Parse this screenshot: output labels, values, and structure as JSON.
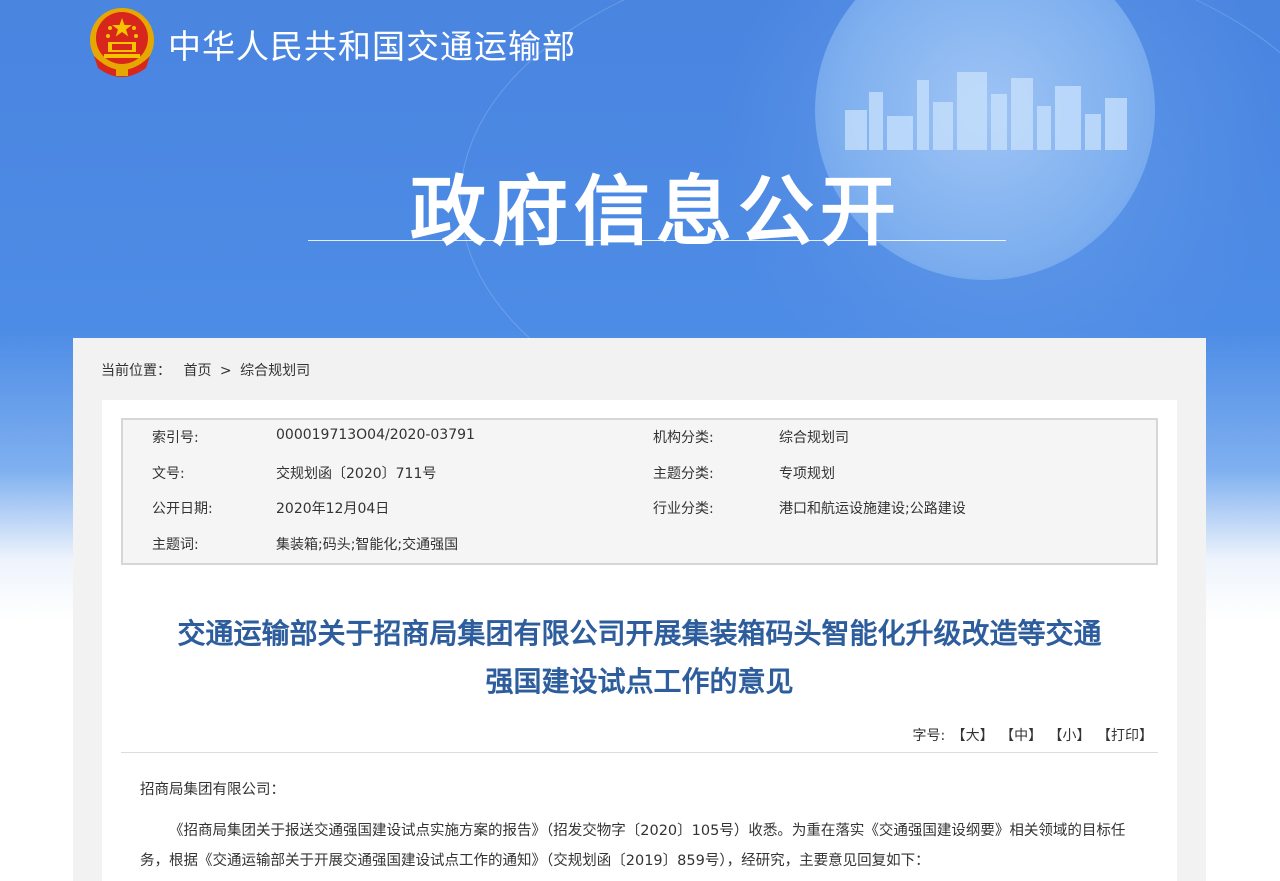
{
  "header": {
    "site_title": "中华人民共和国交通运输部",
    "hero_title": "政府信息公开"
  },
  "breadcrumb": {
    "label": "当前位置：",
    "items": [
      "首页",
      "综合规划司"
    ],
    "separator": ">"
  },
  "meta": {
    "index_label": "索引号:",
    "index_value": "000019713O04/2020-03791",
    "org_label": "机构分类:",
    "org_value": "综合规划司",
    "doc_label": "文号:",
    "doc_value": "交规划函〔2020〕711号",
    "topic_label": "主题分类:",
    "topic_value": "专项规划",
    "date_label": "公开日期:",
    "date_value": "2020年12月04日",
    "industry_label": "行业分类:",
    "industry_value": "港口和航运设施建设;公路建设",
    "keywords_label": "主题词:",
    "keywords_value": "集装箱;码头;智能化;交通强国"
  },
  "document": {
    "title_line1": "交通运输部关于招商局集团有限公司开展集装箱码头智能化升级改造等交通",
    "title_line2": "强国建设试点工作的意见",
    "addressee": "招商局集团有限公司：",
    "paragraph1": "《招商局集团关于报送交通强国建设试点实施方案的报告》（招发交物字〔2020〕105号）收悉。为重在落实《交通强国建设纲要》相关领域的目标任务，根据《交通运输部关于开展交通强国建设试点工作的通知》（交规划函〔2019〕859号），经研究，主要意见回复如下："
  },
  "font_controls": {
    "label": "字号:",
    "large": "【大】",
    "medium": "【中】",
    "small": "【小】",
    "print": "【打印】"
  },
  "colors": {
    "banner_blue": "#4d8ce6",
    "title_blue": "#2d5d9c",
    "emblem_red": "#d9261c",
    "emblem_gold": "#f5c400"
  }
}
